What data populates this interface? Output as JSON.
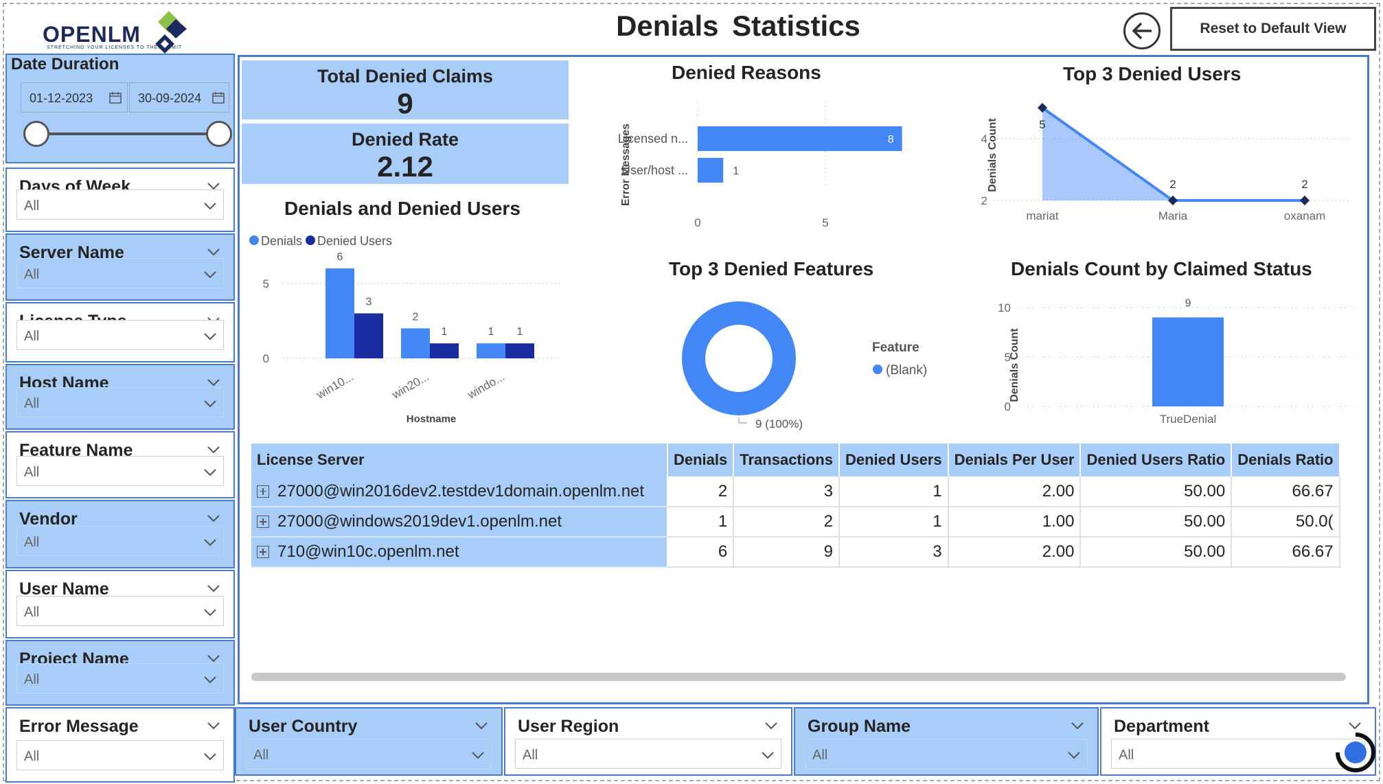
{
  "brand": {
    "name": "OPENLM",
    "tagline": "STRETCHING YOUR LICENSES TO THEIR LIMIT"
  },
  "header": {
    "title": "Denials  Statistics",
    "reset_label": "Reset to Default View"
  },
  "date_slicer": {
    "title": "Date Duration",
    "start": "01-12-2023",
    "end": "30-09-2024"
  },
  "slicers": [
    {
      "title": "Days of Week",
      "value": "All"
    },
    {
      "title": "Server Name",
      "value": "All"
    },
    {
      "title": "License Type",
      "value": "All"
    },
    {
      "title": "Host Name",
      "value": "All"
    },
    {
      "title": "Feature Name",
      "value": "All"
    },
    {
      "title": "Vendor",
      "value": "All"
    },
    {
      "title": "User Name",
      "value": "All"
    },
    {
      "title": "Project Name",
      "value": "All"
    },
    {
      "title": "Error Message",
      "value": "All"
    }
  ],
  "bottom_slicers": [
    {
      "title": "User Country",
      "value": "All"
    },
    {
      "title": "User Region",
      "value": "All"
    },
    {
      "title": "Group Name",
      "value": "All"
    },
    {
      "title": "Department",
      "value": "All"
    }
  ],
  "kpis": {
    "total_label": "Total Denied Claims",
    "total_value": "9",
    "rate_label": "Denied Rate",
    "rate_value": "2.12"
  },
  "colors": {
    "accent": "#4287f5",
    "dark": "#1a2da0",
    "panel": "#a7cdf8",
    "border": "#4b7bc8"
  },
  "chart_data": [
    {
      "type": "bar",
      "title": "Denials and Denied Users",
      "xlabel": "Hostname",
      "ylabel": "",
      "legend": "top-left",
      "categories": [
        "win10...",
        "win20...",
        "windo..."
      ],
      "series": [
        {
          "name": "Denials",
          "values": [
            6,
            2,
            1
          ]
        },
        {
          "name": "Denied Users",
          "values": [
            3,
            1,
            1
          ]
        }
      ],
      "yticks": [
        "0",
        "5"
      ],
      "ylim": [
        0,
        6.5
      ]
    },
    {
      "type": "bar",
      "orientation": "horizontal",
      "title": "Denied Reasons",
      "ylabel": "Error Messages",
      "categories": [
        "Licensed n...",
        "User/host ..."
      ],
      "values": [
        8,
        1
      ],
      "xticks": [
        "0",
        "5"
      ],
      "xlim": [
        0,
        10
      ]
    },
    {
      "type": "area",
      "title": "Top 3 Denied Users",
      "ylabel": "Denials Count",
      "categories": [
        "mariat",
        "Maria",
        "oxanam"
      ],
      "values": [
        5,
        2,
        2
      ],
      "yticks": [
        "2",
        "4"
      ],
      "ylim": [
        2,
        5
      ]
    },
    {
      "type": "pie",
      "title": "Top 3 Denied Features",
      "legend_title": "Feature",
      "labels": [
        "(Blank)"
      ],
      "values": [
        9
      ],
      "data_label": "9 (100%)"
    },
    {
      "type": "bar",
      "title": "Denials Count by Claimed Status",
      "ylabel": "Denials Count",
      "categories": [
        "TrueDenial"
      ],
      "values": [
        9
      ],
      "yticks": [
        "0",
        "5",
        "10"
      ],
      "ylim": [
        0,
        10
      ]
    }
  ],
  "table": {
    "columns": [
      "License Server",
      "Denials",
      "Transactions",
      "Denied Users",
      "Denials Per User",
      "Denied Users Ratio",
      "Denials Ratio"
    ],
    "rows": [
      [
        "27000@win2016dev2.testdev1domain.openlm.net",
        "2",
        "3",
        "1",
        "2.00",
        "50.00",
        "66.67"
      ],
      [
        "27000@windows2019dev1.openlm.net",
        "1",
        "2",
        "1",
        "1.00",
        "50.00",
        "50.0("
      ],
      [
        "710@win10c.openlm.net",
        "6",
        "9",
        "3",
        "2.00",
        "50.00",
        "66.67"
      ]
    ]
  }
}
